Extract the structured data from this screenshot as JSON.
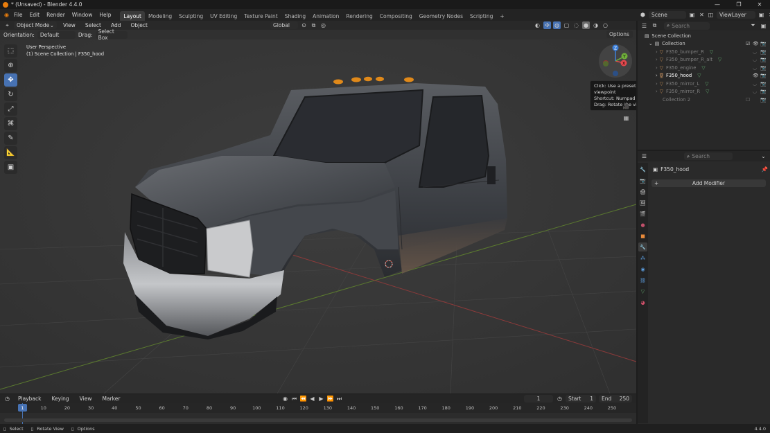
{
  "window": {
    "title": "* (Unsaved) - Blender 4.4.0",
    "min_glyph": "—",
    "max_glyph": "❐",
    "close_glyph": "✕"
  },
  "menu": [
    "File",
    "Edit",
    "Render",
    "Window",
    "Help"
  ],
  "workspaces": [
    "Layout",
    "Modeling",
    "Sculpting",
    "UV Editing",
    "Texture Paint",
    "Shading",
    "Animation",
    "Rendering",
    "Compositing",
    "Geometry Nodes",
    "Scripting"
  ],
  "workspace_add": "+",
  "scene": {
    "name": "Scene",
    "view_layer": "ViewLayer"
  },
  "viewport_header": {
    "mode": "Object Mode",
    "menus": [
      "View",
      "Select",
      "Add",
      "Object"
    ],
    "transform_orientation": "Global",
    "options_label": "Options"
  },
  "tool_settings": {
    "orientation_label": "Orientation:",
    "orientation_value": "Default",
    "drag_label": "Drag:",
    "drag_value": "Select Box"
  },
  "viewport": {
    "perspective": "User Perspective",
    "collection_info": "(1) Scene Collection | F350_hood",
    "gizmo": {
      "z": "Z",
      "y": "Y",
      "x": "X"
    },
    "tooltip": {
      "line1": "Click: Use a preset viewpoint",
      "line2": "Shortcut: Numpad 1",
      "line3": "Drag: Rotate the view"
    }
  },
  "outliner": {
    "search_placeholder": "Search",
    "root": "Scene Collection",
    "collection": "Collection",
    "items": [
      {
        "name": "F350_bumper_R",
        "dim": true
      },
      {
        "name": "F350_bumper_R_alt",
        "dim": true
      },
      {
        "name": "F350_engine",
        "dim": true
      },
      {
        "name": "F350_hood",
        "dim": false
      },
      {
        "name": "F350_mirror_L",
        "dim": true
      },
      {
        "name": "F350_mirror_R",
        "dim": true
      }
    ],
    "collection2": "Collection 2"
  },
  "properties": {
    "search_placeholder": "Search",
    "object_name": "F350_hood",
    "add_modifier": "Add Modifier"
  },
  "timeline": {
    "menus": [
      "Playback",
      "Keying",
      "View",
      "Marker"
    ],
    "current_frame": "1",
    "start_label": "Start",
    "start_value": "1",
    "end_label": "End",
    "end_value": "250",
    "ticks": [
      "1",
      "10",
      "20",
      "30",
      "40",
      "50",
      "60",
      "70",
      "80",
      "90",
      "100",
      "110",
      "120",
      "130",
      "140",
      "150",
      "160",
      "170",
      "180",
      "190",
      "200",
      "210",
      "220",
      "230",
      "240",
      "250"
    ]
  },
  "status": {
    "select": "Select",
    "rotate_view": "Rotate View",
    "options": "Options",
    "version": "4.4.0"
  },
  "colors": {
    "accent": "#4772b3",
    "brand_orange": "#e87d0d",
    "gizmo_x": "#e5484d",
    "gizmo_y": "#6fae3a",
    "gizmo_z": "#3d7fd8",
    "axis_x_line": "#8c3a3a",
    "axis_y_line": "#5b7a2f"
  }
}
